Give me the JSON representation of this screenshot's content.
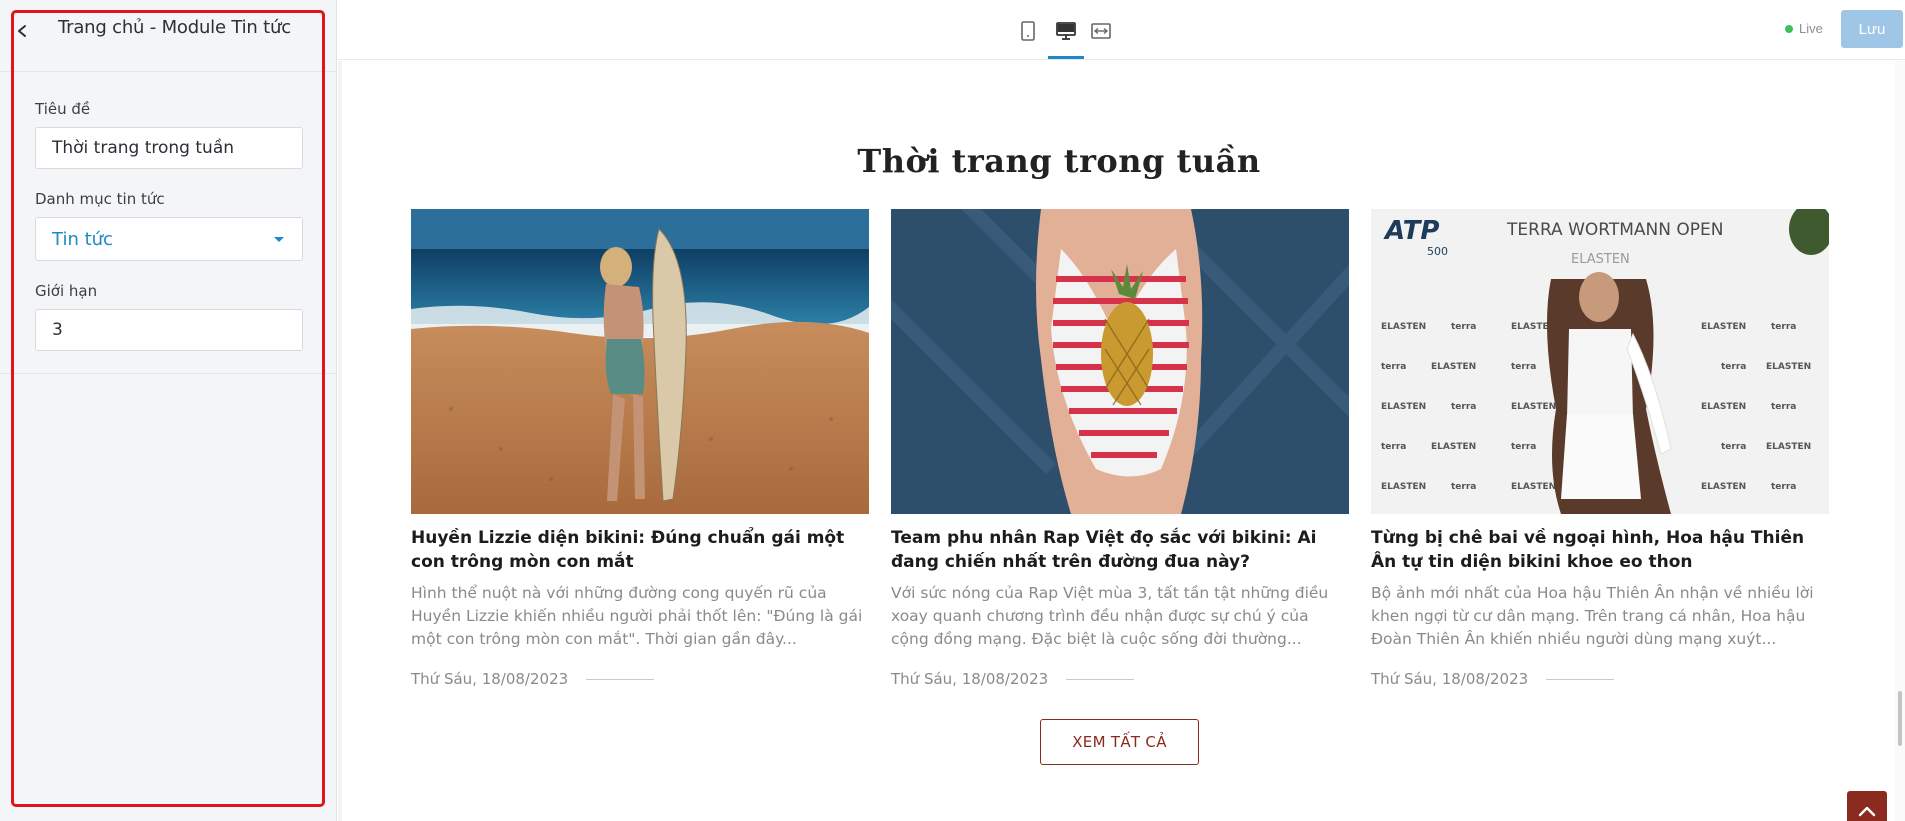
{
  "sidebar": {
    "title": "Trang chủ - Module Tin tức",
    "fields": {
      "title_label": "Tiêu đề",
      "title_value": "Thời trang trong tuần",
      "category_label": "Danh mục tin tức",
      "category_value": "Tin tức",
      "limit_label": "Giới hạn",
      "limit_value": "3"
    }
  },
  "topbar": {
    "devices": [
      "tablet-icon",
      "desktop-icon",
      "fullwidth-icon"
    ],
    "active_device": "desktop-icon",
    "live_label": "Live",
    "save_label": "Lưu"
  },
  "preview": {
    "section_title": "Thời trang trong tuần",
    "articles": [
      {
        "title": "Huyền Lizzie diện bikini: Đúng chuẩn gái một con trông mòn con mắt",
        "excerpt": "Hình thể nuột nà với những đường cong quyến rũ của Huyền Lizzie khiến nhiều người phải thốt lên: \"Đúng là gái một con trông mòn con mắt\". Thời gian gần đây...",
        "date": "Thứ Sáu, 18/08/2023"
      },
      {
        "title": "Team phu nhân Rap Việt đọ sắc với bikini: Ai đang chiến nhất trên đường đua này?",
        "excerpt": "Với sức nóng của Rap Việt mùa 3, tất tần tật những điều xoay quanh chương trình đều nhận được sự chú ý của cộng đồng mạng. Đặc biệt là cuộc sống đời thường...",
        "date": "Thứ Sáu, 18/08/2023"
      },
      {
        "title": "Từng bị chê bai về ngoại hình, Hoa hậu Thiên Ân tự tin diện bikini khoe eo thon",
        "excerpt": "Bộ ảnh mới nhất của Hoa hậu Thiên Ân nhận về nhiều lời khen ngợi từ cư dân mạng. Trên trang cá nhân, Hoa hậu Đoàn Thiên Ân khiến nhiều người dùng mạng xuýt...",
        "date": "Thứ Sáu, 18/08/2023"
      }
    ],
    "photo3_banner": {
      "logo": "ATP",
      "logo_sub": "500",
      "event": "TERRA WORTMANN OPEN",
      "sponsor": "ELASTEN"
    },
    "view_all_label": "XEM TẤT CẢ"
  },
  "colors": {
    "accent": "#1e88c8",
    "brand": "#8b2a1e",
    "highlight": "#e3131c",
    "live": "#3dc15a"
  }
}
